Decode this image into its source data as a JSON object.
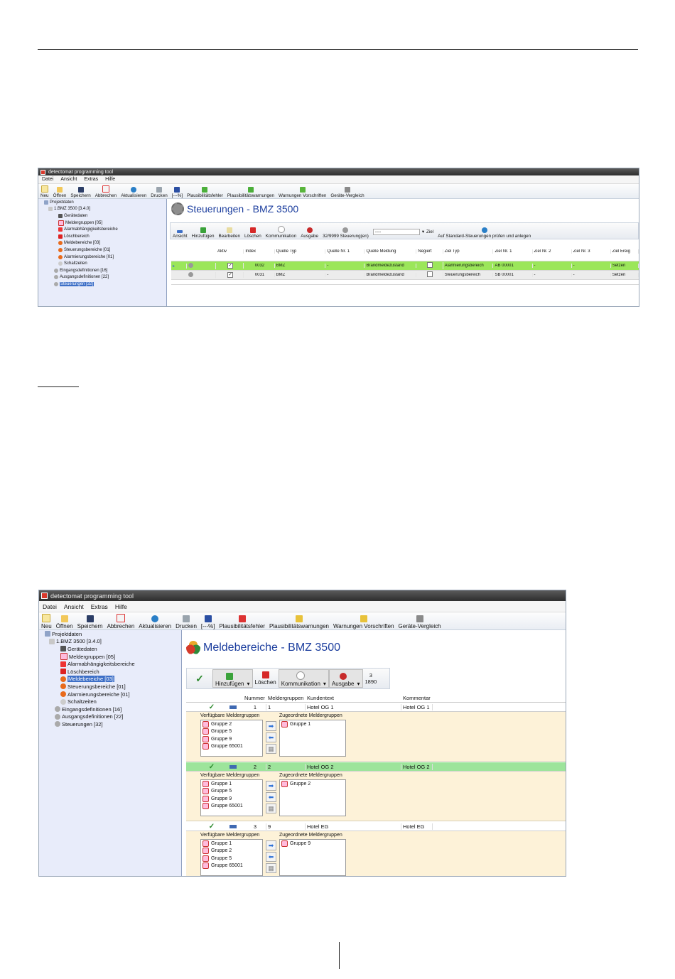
{
  "app_title": "detectomat programming tool",
  "menu": [
    "Datei",
    "Ansicht",
    "Extras",
    "Hilfe"
  ],
  "toolbar": [
    "Neu",
    "Öffnen",
    "Speichern",
    "Abbrechen",
    "Aktualisieren",
    "Drucken",
    "[---%]",
    "Plausibilitätsfehler",
    "Plausibilitätswarnungen",
    "Warnungen Vorschriften",
    "Geräte-Vergleich"
  ],
  "tree": {
    "root": "Projektdaten",
    "device": "1.BMZ 3500 [3.4.0]",
    "items": [
      "Gerätedaten",
      "Meldergruppen [05]",
      "Alarmabhängigkeitsbereiche",
      "Löschbereich",
      "Meldebereiche [03]",
      "Steuerungsbereiche [01]",
      "Alarmierungsbereiche [01]",
      "Schaltzeiten",
      "Eingangsdefinitionen [16]",
      "Ausgangsdefinitionen [22]",
      "Steuerungen [32]"
    ]
  },
  "screen1": {
    "title": "Steuerungen - BMZ 3500",
    "subtoolbar": {
      "ansicht": "Ansicht",
      "hinzufuegen": "Hinzufügen",
      "bearbeiten": "Bearbeiten",
      "loeschen": "Löschen",
      "kommunikation": "Kommunikation",
      "ausgabe": "Ausgabe",
      "count": "32/9999 Steuerung(en)",
      "dropdown": "----",
      "ziel": "Ziel",
      "pruefen": "Auf Standard-Steuerungen prüfen und anlegen"
    },
    "columns": [
      "Aktiv",
      "Index",
      "Quelle Typ",
      "Quelle Nr. 1",
      "Quelle Meldung",
      "Negiert",
      "Ziel Typ",
      "Ziel Nr. 1",
      "Ziel Nr. 2",
      "Ziel Nr. 3",
      "Ziel Ereig"
    ],
    "rows": [
      {
        "aktiv": "✓",
        "index": "0032",
        "quelle_typ": "BMZ",
        "quelle_nr": "-",
        "quelle_meldung": "Brandmeldezustand",
        "ziel_typ": "Alarmierungsbereich",
        "ziel_nr1": "AB 00001",
        "ziel_nr2": "-",
        "ziel_nr3": "-",
        "ziel_ereig": "Setzen"
      },
      {
        "aktiv": "✓",
        "index": "0031",
        "quelle_typ": "BMZ",
        "quelle_nr": "-",
        "quelle_meldung": "Brandmeldezustand",
        "ziel_typ": "Steuerungsbereich",
        "ziel_nr1": "SB 00001",
        "ziel_nr2": "-",
        "ziel_nr3": "-",
        "ziel_ereig": "Setzen"
      }
    ]
  },
  "screen2": {
    "title": "Meldebereiche - BMZ 3500",
    "subtoolbar": {
      "hinzufuegen": "Hinzufügen",
      "loeschen": "Löschen",
      "kommunikation": "Kommunikation",
      "ausgabe": "Ausgabe",
      "count_top": "3",
      "count_bottom": "1890"
    },
    "columns": [
      "Nummer",
      "Meldergruppen",
      "Kundentext",
      "Kommentar"
    ],
    "available_label": "Verfügbare Meldergruppen",
    "assigned_label": "Zugeordnete Meldergruppen",
    "records": [
      {
        "nummer": "1",
        "meldergruppen": "1",
        "kundentext": "Hotel OG 1",
        "kommentar": "Hotel OG 1",
        "available": [
          "Gruppe 2",
          "Gruppe 5",
          "Gruppe 9",
          "Gruppe 65001"
        ],
        "assigned": [
          "Gruppe 1"
        ]
      },
      {
        "nummer": "2",
        "meldergruppen": "2",
        "kundentext": "Hotel OG 2",
        "kommentar": "Hotel OG 2",
        "available": [
          "Gruppe 1",
          "Gruppe 5",
          "Gruppe 9",
          "Gruppe 65001"
        ],
        "assigned": [
          "Gruppe 2"
        ]
      },
      {
        "nummer": "3",
        "meldergruppen": "9",
        "kundentext": "Hotel EG",
        "kommentar": "Hotel EG",
        "available": [
          "Gruppe 1",
          "Gruppe 2",
          "Gruppe 5",
          "Gruppe 65001"
        ],
        "assigned": [
          "Gruppe 9"
        ]
      }
    ]
  },
  "colors": {
    "selected_row": "#9be65a",
    "detail_bg": "#fdf2d8",
    "title_blue": "#1c3e9e",
    "tree_bg": "#e8ecfa"
  }
}
